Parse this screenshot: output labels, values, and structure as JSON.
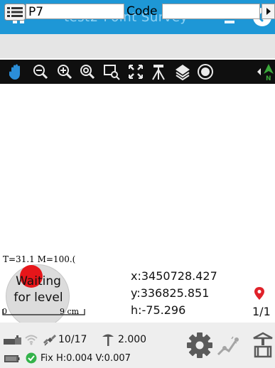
{
  "colors": {
    "titlebar": "#1e97d6",
    "title_text": "#8fd2f4",
    "toolbar": "#0f0f0f",
    "accent_red": "#e6161a",
    "fix_green": "#33b24a"
  },
  "titlebar": {
    "title": "test2-Point Survey",
    "home_icon": "home-icon",
    "minimize_icon": "minimize-icon",
    "back_icon": "back-arrow-icon"
  },
  "pointrow": {
    "menu_icon": "list-menu-icon",
    "point_value": "P7",
    "code_label": "Code",
    "code_value": "",
    "arrow_icon": "play-arrow-icon"
  },
  "toolbar": {
    "tools": [
      "pan-hand-icon",
      "zoom-out-icon",
      "zoom-in-icon",
      "zoom-extent-icon",
      "zoom-window-icon",
      "fit-all-icon",
      "instrument-icon",
      "layers-icon",
      "target-icon",
      "north-arrow-icon"
    ]
  },
  "map": {
    "status_text": "T=31.1 M=100.(",
    "level_text_1": "Waiting",
    "level_text_2": "for level",
    "scale_start": "0",
    "scale_end": "9 cm",
    "x_value": "x:3450728.427",
    "y_value": "y:336825.851",
    "h_value": "h:-75.296",
    "page_indicator": "1/1"
  },
  "bottom": {
    "satellites": "10/17",
    "antenna_height": "2.000",
    "fix_text": "Fix H:0.004 V:0.007",
    "icons": [
      "receiver-icon",
      "wifi-icon",
      "satellite-icon",
      "antenna-icon",
      "battery-icon",
      "fix-status-icon",
      "settings-gear-icon",
      "survey-line-icon",
      "stakeout-icon"
    ]
  }
}
